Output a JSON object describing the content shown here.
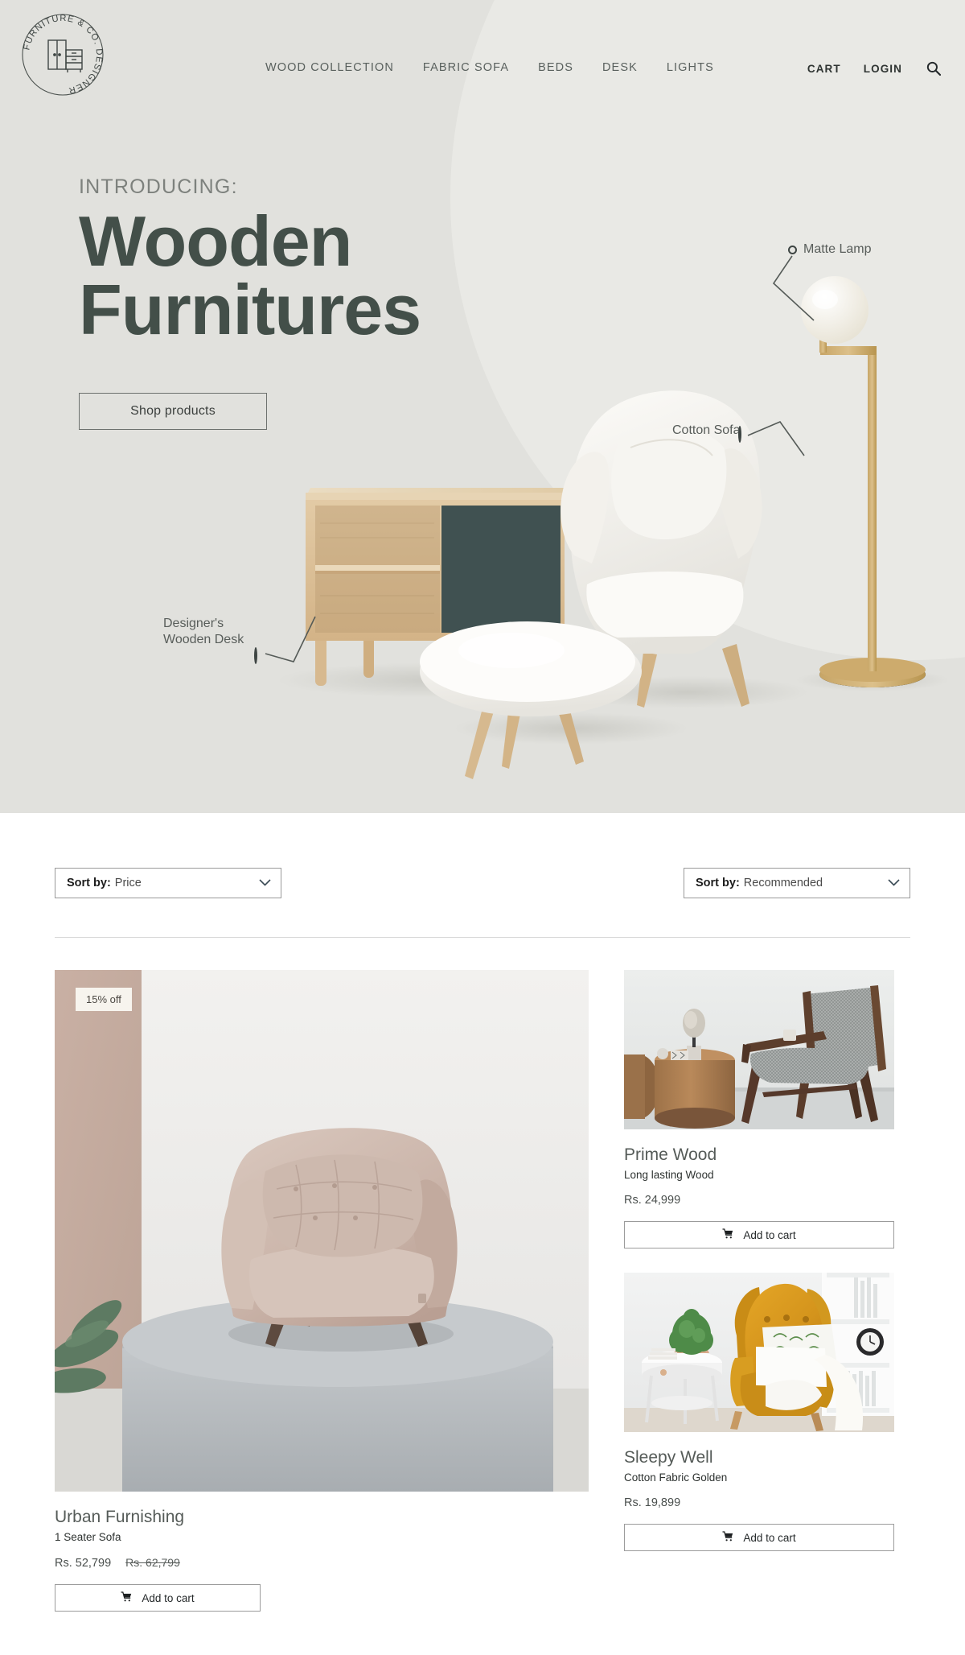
{
  "brand": {
    "logo_text": "FURNITURE & CO. DESIGNER",
    "logo_icon": "wardrobe-dresser-icon"
  },
  "nav": {
    "items": [
      {
        "label": "WOOD COLLECTION",
        "name": "nav-wood-collection"
      },
      {
        "label": "FABRIC SOFA",
        "name": "nav-fabric-sofa"
      },
      {
        "label": "BEDS",
        "name": "nav-beds"
      },
      {
        "label": "DESK",
        "name": "nav-desk"
      },
      {
        "label": "LIGHTS",
        "name": "nav-lights"
      }
    ],
    "cart_label": "CART",
    "login_label": "LOGIN",
    "search_icon": "search-icon"
  },
  "hero": {
    "kicker": "INTRODUCING:",
    "title_line1": "Wooden",
    "title_line2": "Furnitures",
    "cta_label": "Shop products",
    "annotations": [
      {
        "label": "Matte Lamp",
        "name": "annotation-matte-lamp"
      },
      {
        "label": "Cotton Sofa",
        "name": "annotation-cotton-sofa"
      },
      {
        "label": "Designer's\nWooden Desk",
        "name": "annotation-wooden-desk"
      }
    ],
    "colors": {
      "background": "#e1e1dd",
      "circle": "#e9e9e5",
      "title": "#434f49",
      "wood": "#d9bd93",
      "panel": "#3c4b4c"
    }
  },
  "catalog": {
    "sort_left": {
      "label": "Sort by:",
      "value": "Price",
      "chevron": "chevron-down-icon"
    },
    "sort_right": {
      "label": "Sort by:",
      "value": "Recommended",
      "chevron": "chevron-down-icon"
    },
    "cart_icon": "shopping-cart-icon",
    "products": [
      {
        "name": "Urban Furnishing",
        "subtitle": "1 Seater Sofa",
        "price": "Rs. 52,799",
        "old_price": "Rs. 62,799",
        "badge": "15% off",
        "cta": "Add to cart",
        "image": "beige-tufted-armchair-on-grey-pedestal"
      },
      {
        "name": "Prime Wood",
        "subtitle": "Long lasting Wood",
        "price": "Rs. 24,999",
        "old_price": "",
        "badge": "",
        "cta": "Add to cart",
        "image": "grey-upholstered-wooden-lounge-chair-with-round-wood-table"
      },
      {
        "name": "Sleepy Well",
        "subtitle": "Cotton Fabric Golden",
        "price": "Rs. 19,899",
        "old_price": "",
        "badge": "",
        "cta": "Add to cart",
        "image": "mustard-yellow-wingback-armchair-with-white-throw"
      }
    ]
  }
}
